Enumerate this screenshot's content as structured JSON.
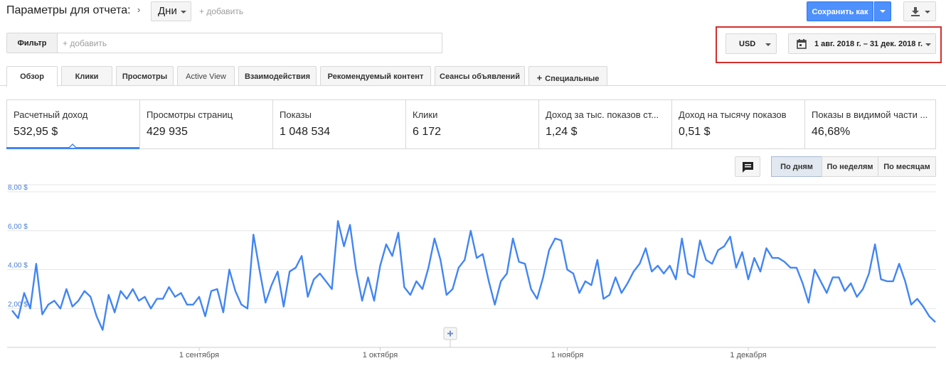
{
  "header": {
    "title": "Параметры для отчета:",
    "dimension": "Дни",
    "add_label": "+ добавить",
    "save_label": "Сохранить как"
  },
  "filter": {
    "label": "Фильтр",
    "placeholder": "+ добавить"
  },
  "currency": "USD",
  "date_range": "1 авг. 2018 г. – 31 дек. 2018 г.",
  "tabs": [
    {
      "label": "Обзор"
    },
    {
      "label": "Клики"
    },
    {
      "label": "Просмотры"
    },
    {
      "label": "Active View"
    },
    {
      "label": "Взаимодействия"
    },
    {
      "label": "Рекомендуемый контент"
    },
    {
      "label": "Сеансы объявлений"
    },
    {
      "label": "Специальные"
    }
  ],
  "metrics": [
    {
      "label": "Расчетный доход",
      "value": "532,95 $"
    },
    {
      "label": "Просмотры страниц",
      "value": "429 935"
    },
    {
      "label": "Показы",
      "value": "1 048 534"
    },
    {
      "label": "Клики",
      "value": "6 172"
    },
    {
      "label": "Доход за тыс. показов ст...",
      "value": "1,24 $"
    },
    {
      "label": "Доход на тысячу показов",
      "value": "0,51 $"
    },
    {
      "label": "Показы в видимой части ...",
      "value": "46,68%"
    }
  ],
  "periods": [
    {
      "label": "По дням",
      "selected": true
    },
    {
      "label": "По неделям",
      "selected": false
    },
    {
      "label": "По месяцам",
      "selected": false
    }
  ],
  "colors": {
    "accent": "#4285f4",
    "save_button": "#4d90fe",
    "highlight": "#d32f2f"
  },
  "chart_data": {
    "type": "line",
    "y_ticks": [
      "8,00 $",
      "6,00 $",
      "4,00 $",
      "2,00 $"
    ],
    "y_tick_values": [
      8,
      6,
      4,
      2
    ],
    "ylim": [
      0,
      8
    ],
    "x_ticks": [
      {
        "label": "1 сентября",
        "index": 31
      },
      {
        "label": "1 октября",
        "index": 61
      },
      {
        "label": "1 ноября",
        "index": 92
      },
      {
        "label": "1 декабря",
        "index": 122
      }
    ],
    "grid": true,
    "series": [
      {
        "color": "#4285f4",
        "values": [
          1.9,
          1.5,
          2.8,
          2.0,
          4.3,
          1.7,
          2.2,
          2.4,
          2.0,
          3.0,
          2.1,
          2.4,
          2.9,
          2.6,
          1.6,
          0.9,
          2.7,
          1.8,
          2.9,
          2.5,
          3.0,
          2.4,
          2.6,
          2.0,
          2.5,
          2.5,
          3.1,
          2.6,
          2.8,
          2.2,
          2.2,
          2.6,
          1.6,
          2.9,
          3.0,
          1.8,
          4.0,
          2.9,
          2.2,
          2.0,
          5.8,
          4.0,
          2.3,
          3.2,
          3.9,
          2.1,
          3.9,
          4.1,
          4.7,
          2.6,
          3.5,
          3.8,
          3.4,
          3.0,
          6.5,
          5.2,
          6.3,
          4.0,
          2.4,
          3.6,
          2.4,
          4.2,
          5.3,
          4.7,
          5.9,
          3.1,
          2.7,
          3.4,
          3.0,
          4.1,
          5.6,
          4.5,
          2.7,
          3.0,
          4.1,
          4.5,
          6.0,
          4.6,
          4.8,
          3.4,
          2.2,
          3.4,
          3.8,
          5.6,
          4.4,
          4.3,
          3.0,
          2.5,
          3.6,
          5.0,
          5.6,
          5.5,
          4.0,
          3.8,
          2.8,
          3.4,
          3.2,
          4.5,
          2.5,
          2.7,
          3.6,
          2.8,
          3.3,
          3.9,
          4.3,
          5.1,
          3.9,
          4.2,
          3.8,
          4.2,
          3.5,
          5.6,
          3.8,
          3.6,
          5.5,
          4.5,
          4.3,
          5.0,
          5.2,
          5.7,
          4.1,
          4.9,
          3.5,
          4.6,
          3.9,
          5.1,
          4.6,
          4.6,
          4.4,
          4.1,
          4.1,
          3.3,
          2.3,
          4.0,
          3.4,
          2.8,
          3.6,
          3.6,
          2.9,
          3.3,
          2.6,
          3.0,
          3.8,
          5.3,
          3.5,
          3.4,
          3.4,
          4.3,
          3.4,
          2.2,
          2.5,
          2.1,
          1.6,
          1.3
        ]
      }
    ]
  }
}
